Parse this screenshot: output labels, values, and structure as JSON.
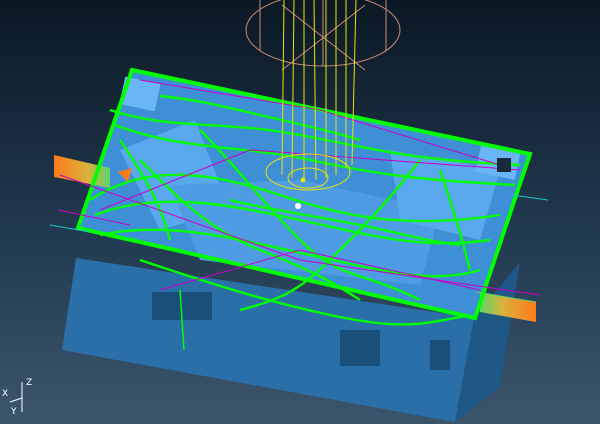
{
  "viewport": {
    "background_top": "#0b1824",
    "background_bottom": "#3b556c",
    "part_color": "#3a8fd8",
    "toolpath_color": "#00ff00",
    "tool_color": "#e6e600",
    "holder_color": "#c98a74",
    "boundary_color": "#c800c8",
    "approach_color": "#ff7a1a"
  },
  "triad": {
    "x_label": "X",
    "y_label": "Y",
    "z_label": "Z"
  }
}
